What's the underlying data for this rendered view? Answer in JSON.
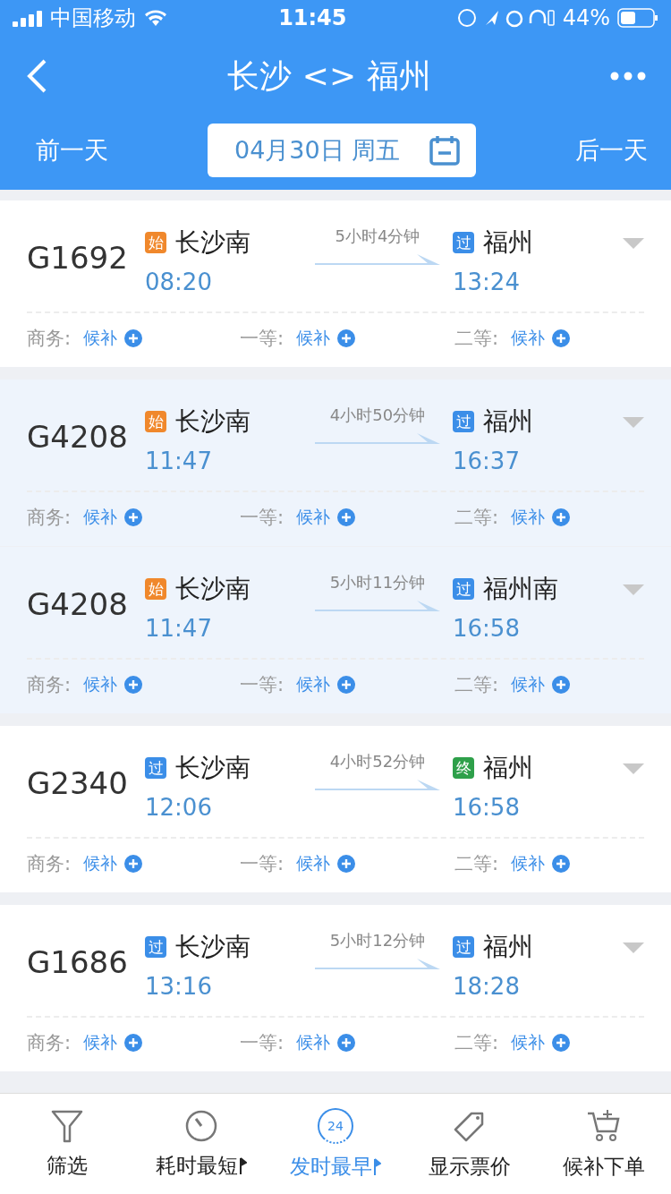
{
  "status_bar": {
    "carrier": "中国移动",
    "time": "11:45",
    "battery": "44%"
  },
  "nav": {
    "title": "长沙 <> 福州"
  },
  "date_bar": {
    "prev": "前一天",
    "date": "04月30日 周五",
    "next": "后一天"
  },
  "trains": [
    {
      "number": "G1692",
      "highlighted": false,
      "from": {
        "badge": "始",
        "color": "#f0882c",
        "station": "长沙南",
        "time": "08:20"
      },
      "duration": "5小时4分钟",
      "to": {
        "badge": "过",
        "color": "#3b8ee8",
        "station": "福州",
        "time": "13:24"
      },
      "seats": [
        {
          "label": "商务:",
          "status": "候补"
        },
        {
          "label": "一等:",
          "status": "候补"
        },
        {
          "label": "二等:",
          "status": "候补"
        }
      ]
    },
    {
      "number": "G4208",
      "highlighted": true,
      "from": {
        "badge": "始",
        "color": "#f0882c",
        "station": "长沙南",
        "time": "11:47"
      },
      "duration": "4小时50分钟",
      "to": {
        "badge": "过",
        "color": "#3b8ee8",
        "station": "福州",
        "time": "16:37"
      },
      "seats": [
        {
          "label": "商务:",
          "status": "候补"
        },
        {
          "label": "一等:",
          "status": "候补"
        },
        {
          "label": "二等:",
          "status": "候补"
        }
      ]
    },
    {
      "number": "G4208",
      "highlighted": true,
      "from": {
        "badge": "始",
        "color": "#f0882c",
        "station": "长沙南",
        "time": "11:47"
      },
      "duration": "5小时11分钟",
      "to": {
        "badge": "过",
        "color": "#3b8ee8",
        "station": "福州南",
        "time": "16:58"
      },
      "seats": [
        {
          "label": "商务:",
          "status": "候补"
        },
        {
          "label": "一等:",
          "status": "候补"
        },
        {
          "label": "二等:",
          "status": "候补"
        }
      ]
    },
    {
      "number": "G2340",
      "highlighted": false,
      "from": {
        "badge": "过",
        "color": "#3b8ee8",
        "station": "长沙南",
        "time": "12:06"
      },
      "duration": "4小时52分钟",
      "to": {
        "badge": "终",
        "color": "#2ea04a",
        "station": "福州",
        "time": "16:58"
      },
      "seats": [
        {
          "label": "商务:",
          "status": "候补"
        },
        {
          "label": "一等:",
          "status": "候补"
        },
        {
          "label": "二等:",
          "status": "候补"
        }
      ]
    },
    {
      "number": "G1686",
      "highlighted": false,
      "from": {
        "badge": "过",
        "color": "#3b8ee8",
        "station": "长沙南",
        "time": "13:16"
      },
      "duration": "5小时12分钟",
      "to": {
        "badge": "过",
        "color": "#3b8ee8",
        "station": "福州",
        "time": "18:28"
      },
      "seats": [
        {
          "label": "商务:",
          "status": "候补"
        },
        {
          "label": "一等:",
          "status": "候补"
        },
        {
          "label": "二等:",
          "status": "候补"
        }
      ]
    }
  ],
  "tab_bar": [
    {
      "kind": "filter",
      "label": "筛选",
      "selected": false
    },
    {
      "kind": "duration",
      "label": "耗时最短",
      "selected": false
    },
    {
      "kind": "departure",
      "label": "发时最早",
      "icon_text": "24",
      "selected": true
    },
    {
      "kind": "price",
      "label": "显示票价",
      "selected": false
    },
    {
      "kind": "waitlist",
      "label": "候补下单",
      "selected": false
    }
  ]
}
